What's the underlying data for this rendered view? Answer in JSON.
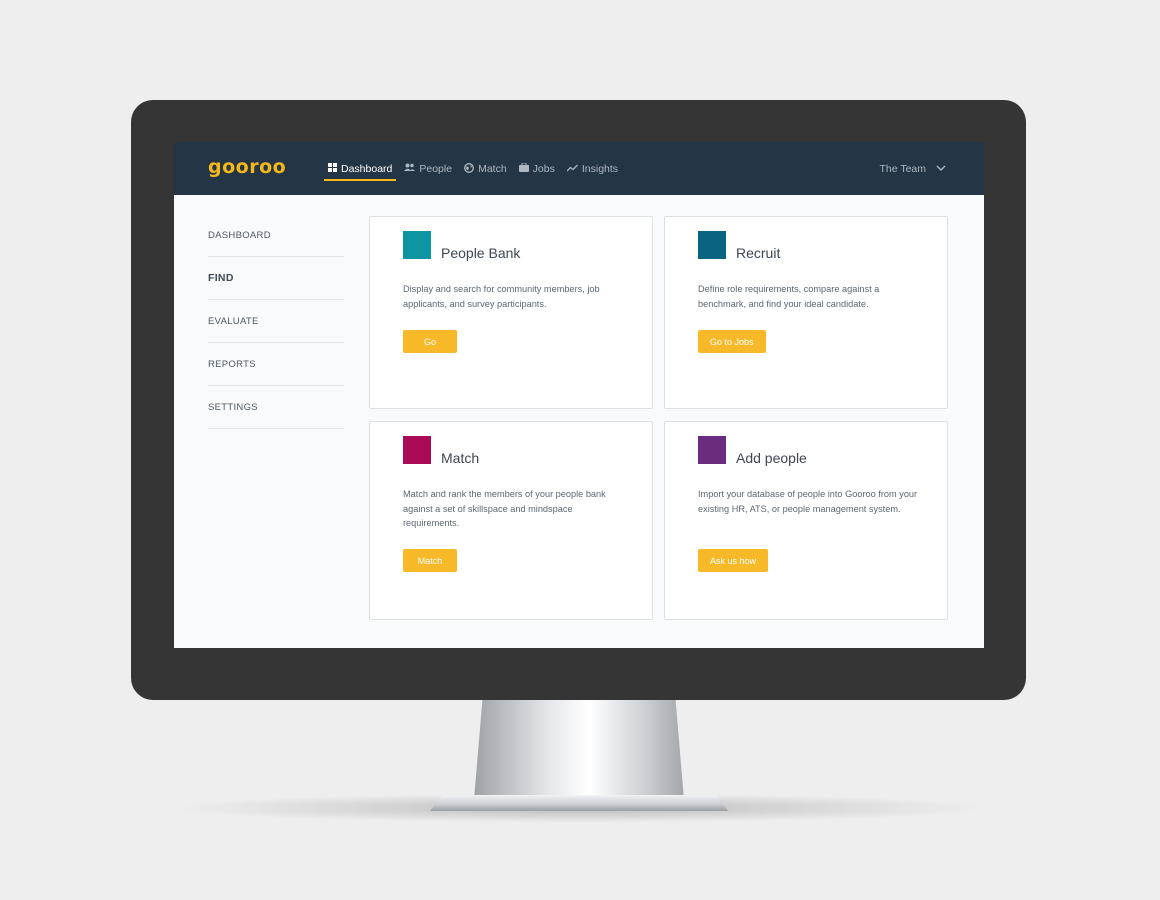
{
  "brand": {
    "logo_text": "gooroo",
    "accent": "#f5b81c",
    "nav_bg": "#243545"
  },
  "nav": {
    "items": [
      {
        "label": "Dashboard",
        "icon": "grid-icon",
        "active": true
      },
      {
        "label": "People",
        "icon": "people-icon",
        "active": false
      },
      {
        "label": "Match",
        "icon": "globe-icon",
        "active": false
      },
      {
        "label": "Jobs",
        "icon": "briefcase-icon",
        "active": false
      },
      {
        "label": "Insights",
        "icon": "trend-icon",
        "active": false
      }
    ],
    "team_label": "The Team"
  },
  "sidebar": {
    "items": [
      {
        "label": "DASHBOARD"
      },
      {
        "label": "FIND"
      },
      {
        "label": "EVALUATE"
      },
      {
        "label": "REPORTS"
      },
      {
        "label": "SETTINGS"
      }
    ]
  },
  "cards": [
    {
      "title": "People Bank",
      "description": "Display and search for community members, job applicants, and survey participants.",
      "button": "Go",
      "color": "#0e95a3"
    },
    {
      "title": "Recruit",
      "description": "Define role requirements, compare against a benchmark, and find your ideal candidate.",
      "button": "Go to Jobs",
      "color": "#0a6381"
    },
    {
      "title": "Match",
      "description": "Match and rank the members of your people bank against a set of skillspace and mindspace requirements.",
      "button": "Match",
      "color": "#ab0a56"
    },
    {
      "title": "Add people",
      "description": "Import your database of people into Gooroo from your existing HR, ATS, or people management system.",
      "button": "Ask us how",
      "color": "#6a2c7f"
    }
  ]
}
